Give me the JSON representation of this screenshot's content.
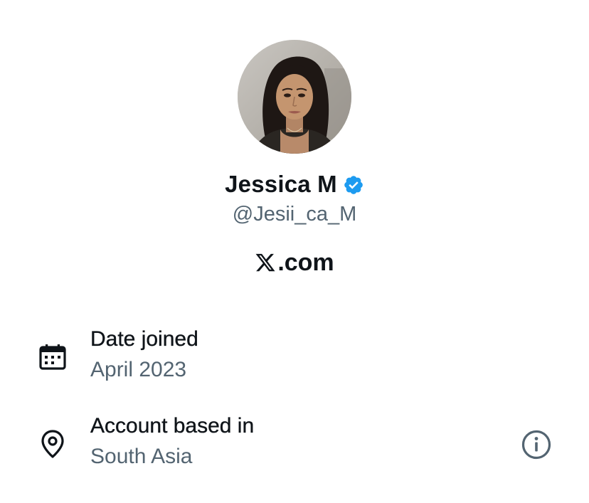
{
  "profile": {
    "display_name": "Jessica M",
    "verified": true,
    "handle": "@Jesii_ca_M",
    "avatar_icon": "profile-photo"
  },
  "brand": {
    "logo_icon": "x-logo-icon",
    "domain_text": ".com"
  },
  "details": {
    "date_joined": {
      "title": "Date joined",
      "value": "April 2023",
      "icon": "calendar-icon"
    },
    "account_based_in": {
      "title": "Account based in",
      "value": "South Asia",
      "icon": "location-pin-icon",
      "info_icon": "info-icon"
    }
  },
  "colors": {
    "text_primary": "#0f1419",
    "text_secondary": "#536471",
    "verified_blue": "#1d9bf0"
  }
}
